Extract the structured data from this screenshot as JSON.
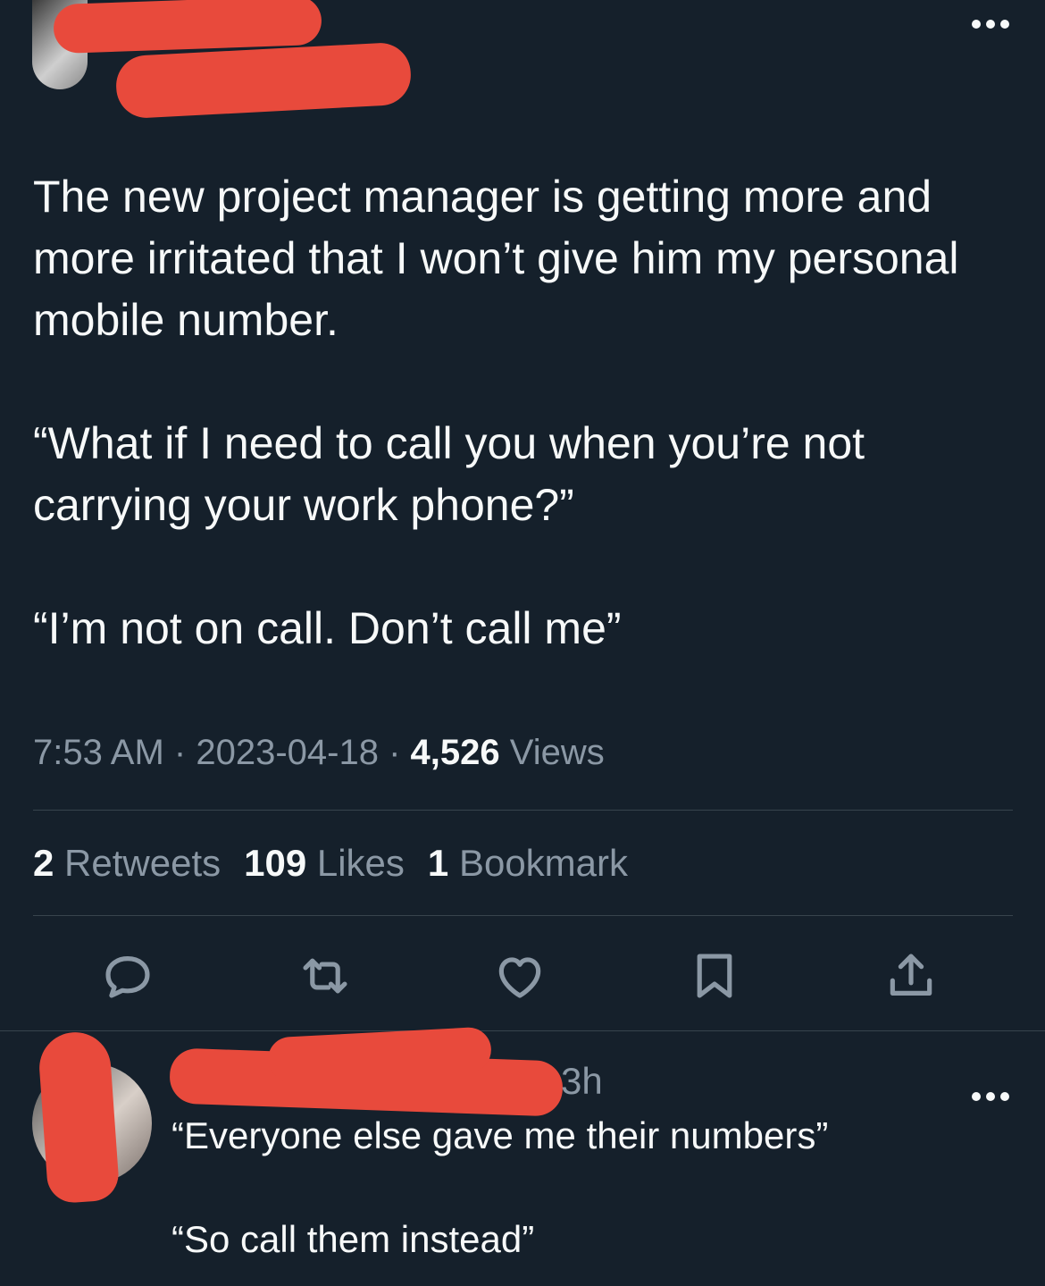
{
  "main_tweet": {
    "more_icon": "ellipsis-icon",
    "text": "The new project manager is getting more and\nmore irritated that I won’t give him my personal\nmobile number.\n\n“What if I need to call you when you’re not\ncarrying your work phone?”\n\n“I’m not on call. Don’t call me”",
    "time": "7:53 AM",
    "date": "2023-04-18",
    "separator": "·",
    "views_count": "4,526",
    "views_label": "Views",
    "retweets_count": "2",
    "retweets_label": "Retweets",
    "likes_count": "109",
    "likes_label": "Likes",
    "bookmarks_count": "1",
    "bookmarks_label": "Bookmark",
    "actions": [
      "reply-icon",
      "retweet-icon",
      "like-icon",
      "bookmark-icon",
      "share-icon"
    ]
  },
  "reply": {
    "time": "3h",
    "text": "“Everyone else gave me their numbers”\n\n“So call them instead”",
    "more_icon": "ellipsis-icon"
  },
  "colors": {
    "background": "#15202b",
    "text": "#f7f9f9",
    "secondary": "#8b98a5",
    "divider": "#38444d",
    "redaction": "#e84a3c"
  }
}
